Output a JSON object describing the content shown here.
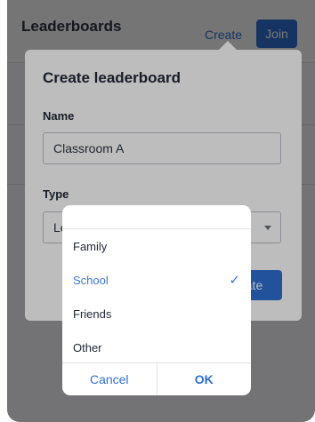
{
  "page": {
    "title": "Leaderboards",
    "create_link": "Create",
    "join_button": "Join"
  },
  "dialog": {
    "title": "Create leaderboard",
    "name_label": "Name",
    "name_value": "Classroom A",
    "type_label": "Type",
    "type_value": "Le",
    "create_button": "ate"
  },
  "picker": {
    "options": [
      {
        "label": "Family"
      },
      {
        "label": "School"
      },
      {
        "label": "Friends"
      },
      {
        "label": "Other"
      }
    ],
    "selected": "School",
    "cancel": "Cancel",
    "ok": "OK"
  },
  "icons": {
    "check": "checkmark-icon",
    "dropdown": "chevron-down-icon"
  },
  "colors": {
    "accent": "#2f6fd1",
    "selected_text": "#3d78d8"
  }
}
